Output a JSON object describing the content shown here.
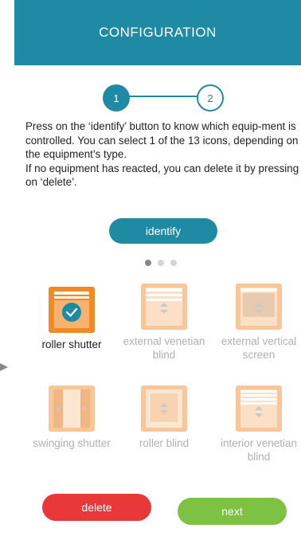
{
  "header": {
    "title": "CONFIGURATION"
  },
  "stepper": {
    "steps": [
      "1",
      "2"
    ],
    "current": 1
  },
  "instructions": {
    "line1": "Press on the ‘identify’ button to know which equip-ment is controlled. You can select 1 of the 13 icons, depending on the equipment’s type.",
    "line2": "If no equipment has reacted, you can delete it by pressing  on ‘delete’."
  },
  "identify_label": "identify",
  "pagination": {
    "pages": 3,
    "current": 1
  },
  "equipment": [
    {
      "label": "roller shutter",
      "icon": "roller-shutter-icon",
      "selected": true
    },
    {
      "label": "external venetian blind",
      "icon": "external-venetian-blind-icon",
      "selected": false
    },
    {
      "label": "external vertical screen",
      "icon": "external-vertical-screen-icon",
      "selected": false
    },
    {
      "label": "swinging shutter",
      "icon": "swinging-shutter-icon",
      "selected": false
    },
    {
      "label": "roller blind",
      "icon": "roller-blind-icon",
      "selected": false
    },
    {
      "label": "interior venetian blind",
      "icon": "interior-venetian-blind-icon",
      "selected": false
    }
  ],
  "actions": {
    "delete_label": "delete",
    "next_label": "next"
  },
  "colors": {
    "header": "#1f8aa3",
    "accent": "#1f8aa3",
    "icon_selected": "#f08a24",
    "icon_faded": "#f7c79a",
    "delete": "#e8383a",
    "next": "#7dc242"
  }
}
